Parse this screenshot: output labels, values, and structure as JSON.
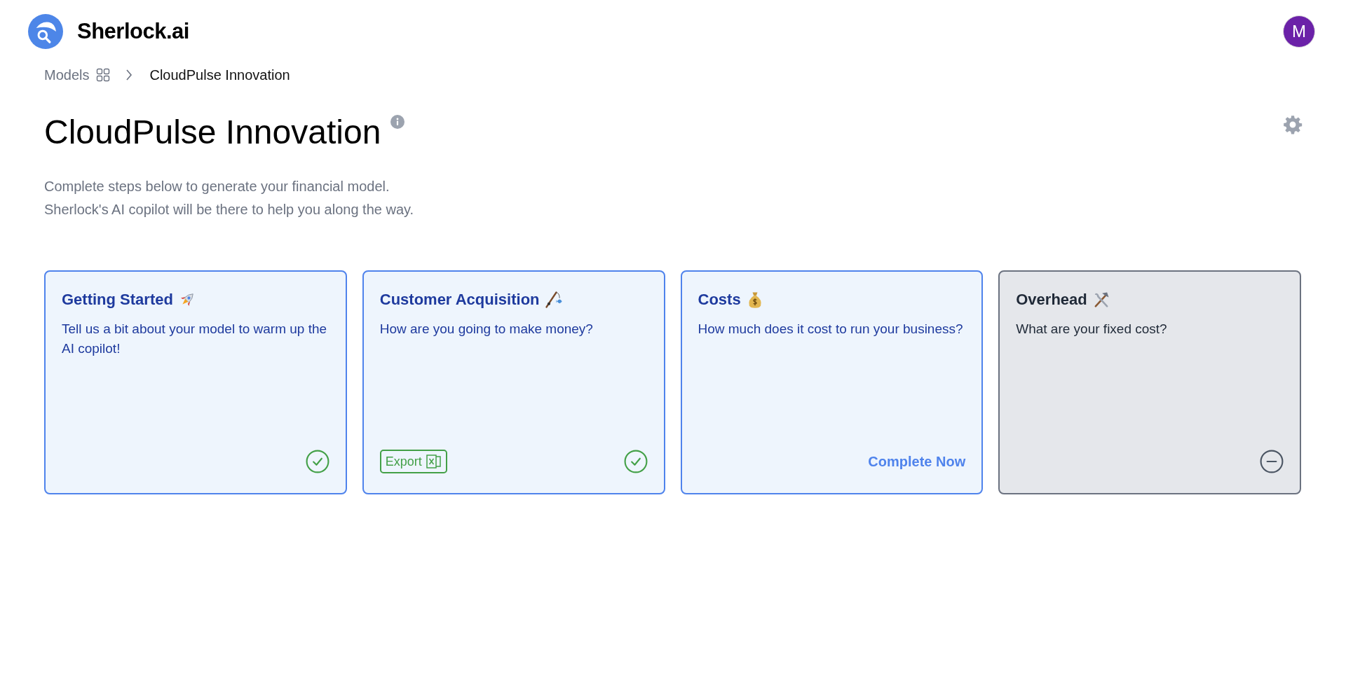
{
  "brand": "Sherlock.ai",
  "avatar": "M",
  "breadcrumb": {
    "parent": "Models",
    "current": "CloudPulse Innovation"
  },
  "title": "CloudPulse Innovation",
  "description": [
    "Complete steps below to generate your financial model.",
    "Sherlock's AI copilot will be there to help you along the way."
  ],
  "steps": [
    {
      "title": "Getting Started",
      "text": "Tell us a bit about your model to warm up the AI copilot!",
      "kind": "done"
    },
    {
      "title": "Customer Acquisition",
      "text": "How are you going to make money?",
      "kind": "done",
      "export": "Export"
    },
    {
      "title": "Costs",
      "text": "How much does it cost to run your business?",
      "kind": "current",
      "action": "Complete Now"
    },
    {
      "title": "Overhead",
      "text": "What are your fixed cost?",
      "kind": "locked"
    }
  ]
}
